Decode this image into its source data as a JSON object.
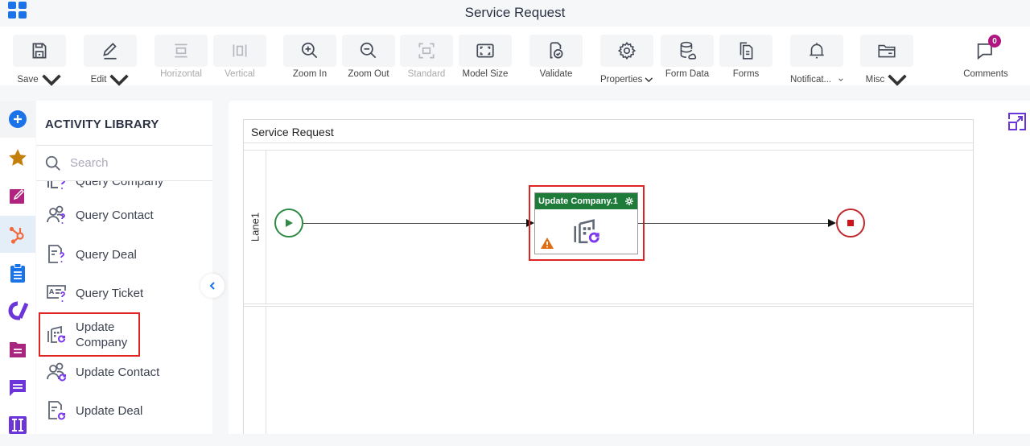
{
  "window": {
    "title": "Service Request"
  },
  "toolbar": {
    "buttons": [
      {
        "id": "save",
        "label": "Save",
        "icon": "save-icon",
        "dropdown": true,
        "enabled": true
      },
      {
        "id": "edit",
        "label": "Edit",
        "icon": "pencil-icon",
        "dropdown": true,
        "enabled": true
      },
      {
        "id": "horizontal",
        "label": "Horizontal",
        "icon": "horizontal-layout-icon",
        "dropdown": false,
        "enabled": false
      },
      {
        "id": "vertical",
        "label": "Vertical",
        "icon": "vertical-layout-icon",
        "dropdown": false,
        "enabled": false
      },
      {
        "id": "zoom_in",
        "label": "Zoom In",
        "icon": "zoom-in-icon",
        "dropdown": false,
        "enabled": true
      },
      {
        "id": "zoom_out",
        "label": "Zoom Out",
        "icon": "zoom-out-icon",
        "dropdown": false,
        "enabled": true
      },
      {
        "id": "standard",
        "label": "Standard",
        "icon": "standard-size-icon",
        "dropdown": false,
        "enabled": false
      },
      {
        "id": "model_size",
        "label": "Model Size",
        "icon": "model-size-icon",
        "dropdown": false,
        "enabled": true
      },
      {
        "id": "validate",
        "label": "Validate",
        "icon": "validate-icon",
        "dropdown": false,
        "enabled": true
      },
      {
        "id": "properties",
        "label": "Properties",
        "icon": "gear-icon",
        "dropdown": true,
        "enabled": true
      },
      {
        "id": "form_data",
        "label": "Form Data",
        "icon": "database-icon",
        "dropdown": false,
        "enabled": true
      },
      {
        "id": "forms",
        "label": "Forms",
        "icon": "forms-icon",
        "dropdown": false,
        "enabled": true
      },
      {
        "id": "notifications",
        "label": "Notificat...",
        "icon": "bell-icon",
        "dropdown": true,
        "enabled": true
      },
      {
        "id": "misc",
        "label": "Misc",
        "icon": "folder-icon",
        "dropdown": true,
        "enabled": true
      }
    ],
    "comments": {
      "label": "Comments",
      "count": "0"
    }
  },
  "rail": {
    "items": [
      {
        "name": "add",
        "icon": "plus-circle-icon",
        "color": "#1a73e8"
      },
      {
        "name": "favorites",
        "icon": "star-icon",
        "color": "#c47f0a"
      },
      {
        "name": "edit-forms",
        "icon": "edit-square-icon",
        "color": "#b0237f"
      },
      {
        "name": "hubspot",
        "icon": "hubspot-icon",
        "color": "#f26a3d",
        "active": true
      },
      {
        "name": "clipboard",
        "icon": "clipboard-icon",
        "color": "#1a73e8"
      },
      {
        "name": "integration",
        "icon": "integration-logo-icon",
        "color": "#6b35d9"
      },
      {
        "name": "document",
        "icon": "document-folder-icon",
        "color": "#a8267e"
      },
      {
        "name": "chat",
        "icon": "chat-icon",
        "color": "#6b35d9"
      },
      {
        "name": "template",
        "icon": "template-icon",
        "color": "#6b35d9"
      }
    ]
  },
  "library": {
    "title": "ACTIVITY LIBRARY",
    "search_placeholder": "Search",
    "items": [
      {
        "label": "Query Company",
        "icon": "query-company-icon"
      },
      {
        "label": "Query Contact",
        "icon": "query-contact-icon"
      },
      {
        "label": "Query Deal",
        "icon": "query-deal-icon"
      },
      {
        "label": "Query Ticket",
        "icon": "query-ticket-icon"
      },
      {
        "label": "Update Company",
        "icon": "update-company-icon",
        "highlighted": true
      },
      {
        "label": "Update Contact",
        "icon": "update-contact-icon"
      },
      {
        "label": "Update Deal",
        "icon": "update-deal-icon"
      }
    ]
  },
  "canvas": {
    "pool_title": "Service Request",
    "lanes": [
      {
        "label": "Lane1"
      },
      {
        "label": ""
      }
    ],
    "task": {
      "label": "Update Company.1",
      "header_color": "#1e7b3a",
      "has_warning": true
    },
    "colors": {
      "start": "#2e8b46",
      "end": "#c0282d",
      "highlight": "#e02424"
    }
  }
}
